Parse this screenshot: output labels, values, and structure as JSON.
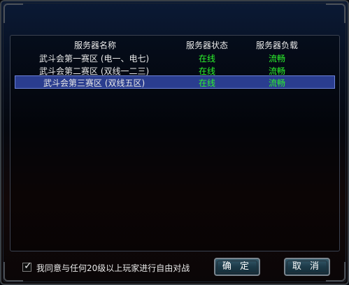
{
  "table": {
    "headers": [
      "服务器名称",
      "服务器状态",
      "服务器负载"
    ],
    "rows": [
      {
        "name": "武斗会第一赛区 (电一、电七)",
        "status": "在线",
        "load": "流畅"
      },
      {
        "name": "武斗会第二赛区 (双线一二三)",
        "status": "在线",
        "load": "流畅"
      },
      {
        "name": "武斗会第三赛区 (双线五区)",
        "status": "在线",
        "load": "流畅"
      }
    ]
  },
  "footer": {
    "agree_checked": true,
    "agree_text": "我同意与任何20级以上玩家进行自由对战",
    "confirm_label": "确 定",
    "cancel_label": "取 消"
  },
  "colors": {
    "status_green": "#2df52d",
    "selection": "#2a3d8f"
  },
  "icons": {
    "checkmark": "check-icon"
  }
}
